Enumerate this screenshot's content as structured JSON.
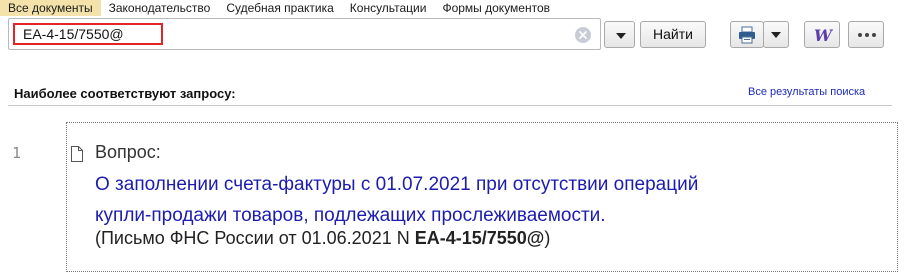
{
  "tabs": [
    {
      "label": "Все документы",
      "active": true
    },
    {
      "label": "Законодательство",
      "active": false
    },
    {
      "label": "Судебная практика",
      "active": false
    },
    {
      "label": "Консультации",
      "active": false
    },
    {
      "label": "Формы документов",
      "active": false
    }
  ],
  "search": {
    "value": "ЕА-4-15/7550@",
    "find_label": "Найти"
  },
  "toolbar": {
    "print_icon": "printer-icon",
    "word_icon": "word-icon",
    "more_icon": "more-icon"
  },
  "results": {
    "heading": "Наиболее соответствуют запросу:",
    "all_results_label": "Все результаты поиска",
    "items": [
      {
        "number": "1",
        "type_label": "Вопрос:",
        "title_line1": "О заполнении счета-фактуры с 01.07.2021 при отсутствии операций",
        "title_line2": "купли-продажи товаров, подлежащих прослеживаемости.",
        "source_prefix": "(Письмо ФНС России от 01.06.2021 N ",
        "source_number": "ЕА-4-15/7550@",
        "source_suffix": ")"
      }
    ]
  },
  "colors": {
    "active_tab": "#f3e2a9",
    "highlight_border": "#e32525",
    "link": "#1c1cb0",
    "word_icon": "#5b3fa8"
  }
}
